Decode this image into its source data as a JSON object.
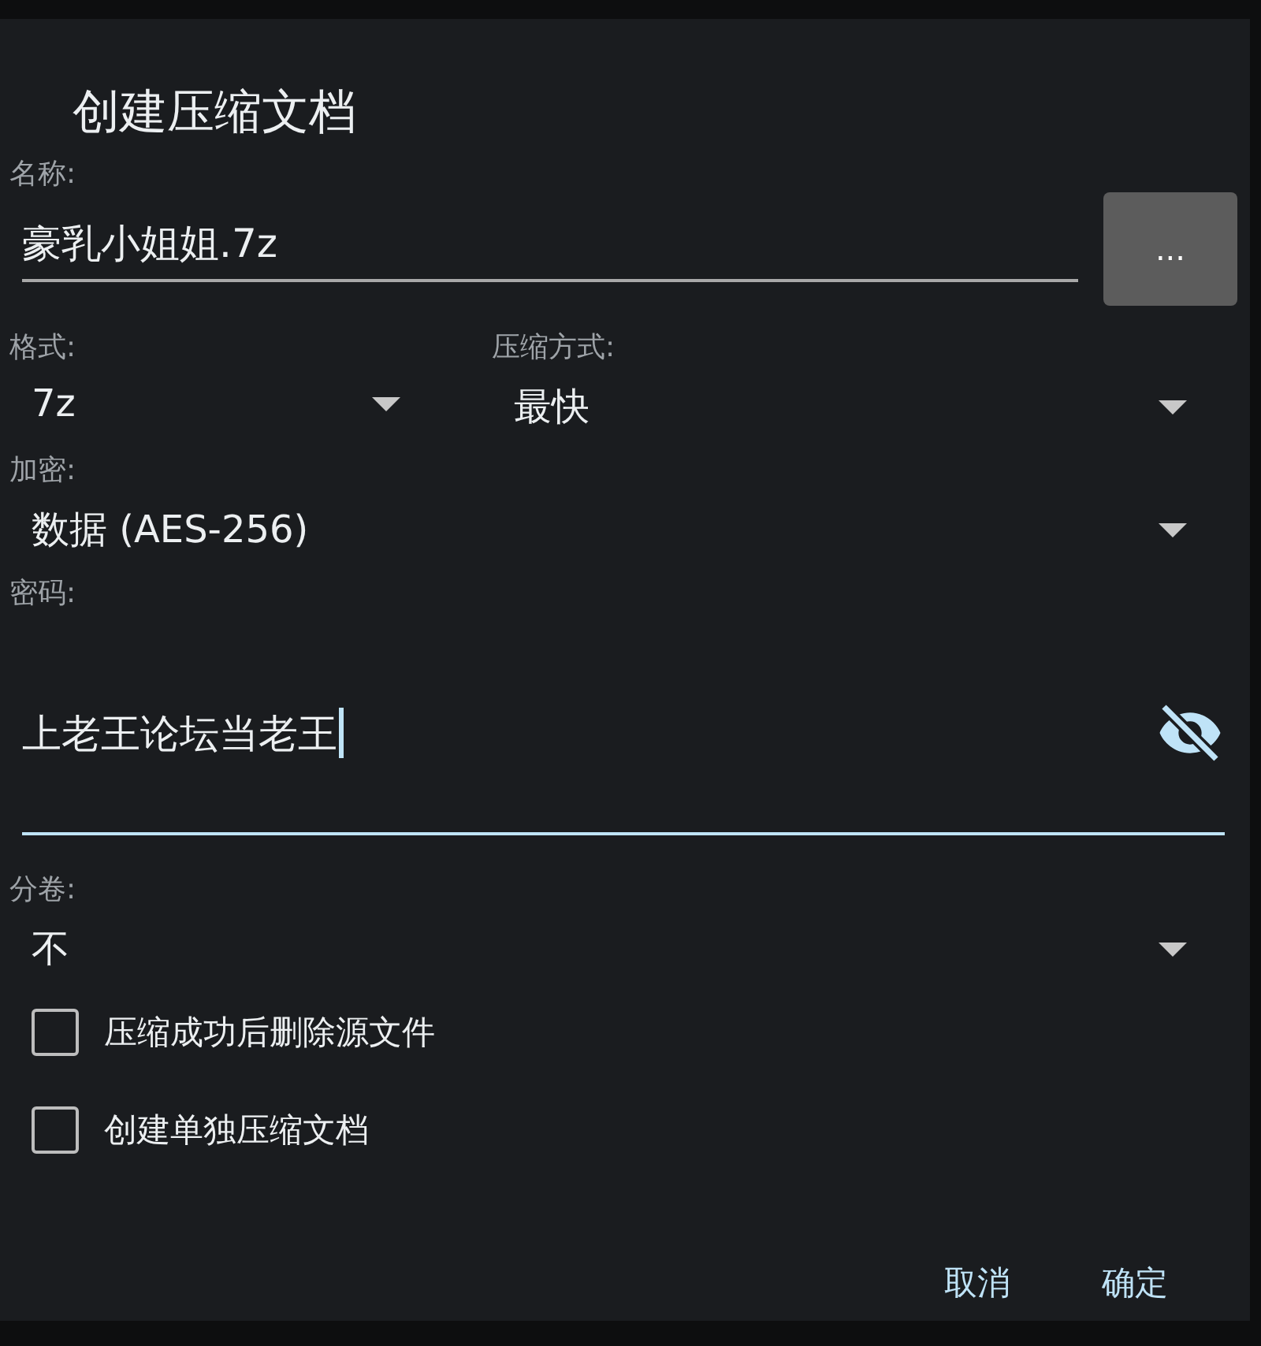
{
  "dialog": {
    "title": "创建压缩文档",
    "name_field": {
      "label": "名称:",
      "value": "豪乳小姐姐.7z",
      "focused": false
    },
    "browse_button": {
      "label": "..."
    },
    "format": {
      "label": "格式:",
      "value": "7z"
    },
    "compression": {
      "label": "压缩方式:",
      "value": "最快"
    },
    "encryption": {
      "label": "加密:",
      "value": "数据 (AES-256)"
    },
    "password": {
      "label": "密码:",
      "value": "上老王论坛当老王",
      "focused": true
    },
    "split": {
      "label": "分卷:",
      "value": "不"
    },
    "options": [
      {
        "label": "压缩成功后删除源文件",
        "checked": false
      },
      {
        "label": "创建单独压缩文档",
        "checked": false
      }
    ],
    "buttons": [
      {
        "label": "取消"
      },
      {
        "label": "确定"
      }
    ]
  }
}
